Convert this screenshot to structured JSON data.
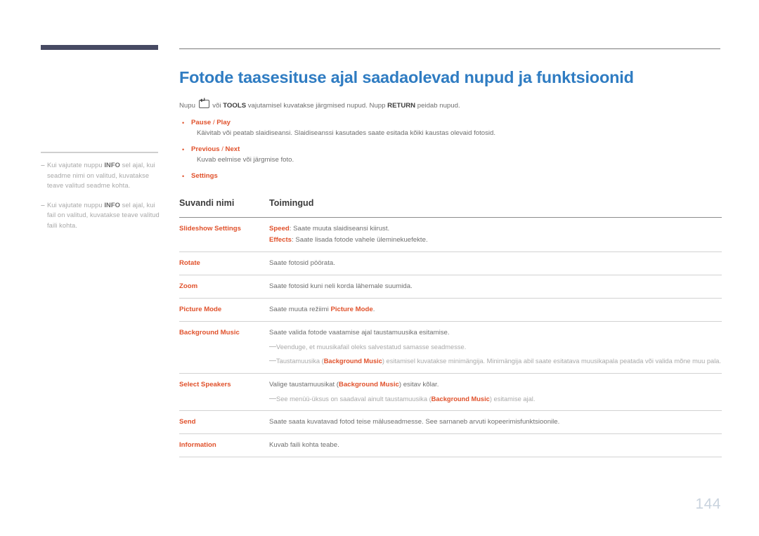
{
  "page": {
    "number": "144",
    "title": "Fotode taasesituse ajal saadaolevad nupud ja funktsioonid",
    "title_color": "#2f7cc2",
    "accent_color": "#e0512b",
    "bar_color": "#474a63"
  },
  "intro": {
    "part1": "Nupu ",
    "key_icon": "enter-key-icon",
    "part2": " või ",
    "bold1": "TOOLS",
    "part3": " vajutamisel kuvatakse järgmised nupud. Nupp ",
    "bold2": "RETURN",
    "part4": " peidab nupud."
  },
  "bullets": [
    {
      "label_a": "Pause",
      "sep": " / ",
      "label_b": "Play",
      "desc": "Käivitab või peatab slaidiseansi. Slaidiseanssi kasutades saate esitada kõiki kaustas olevaid fotosid."
    },
    {
      "label_a": "Previous",
      "sep": " / ",
      "label_b": "Next",
      "desc": "Kuvab eelmise või järgmise foto."
    },
    {
      "label_a": "Settings",
      "sep": "",
      "label_b": "",
      "desc": ""
    }
  ],
  "sidebar": {
    "notes": [
      {
        "dash": "–",
        "before": "Kui vajutate nuppu ",
        "bold": "INFO",
        "after": " sel ajal, kui seadme nimi on valitud, kuvatakse teave valitud seadme kohta."
      },
      {
        "dash": "–",
        "before": "Kui vajutate nuppu ",
        "bold": "INFO",
        "after": " sel ajal, kui fail on valitud, kuvatakse teave valitud faili kohta."
      }
    ]
  },
  "table": {
    "headers": {
      "name": "Suvandi nimi",
      "action": "Toimingud"
    },
    "rows": [
      {
        "name": "Slideshow Settings",
        "lines": [
          {
            "term": "Speed",
            "text": ": Saate muuta slaidiseansi kiirust."
          },
          {
            "term": "Effects",
            "text": ": Saate lisada fotode vahele üleminekuefekte."
          }
        ],
        "notes": []
      },
      {
        "name": "Rotate",
        "lines": [
          {
            "term": "",
            "text": "Saate fotosid pöörata."
          }
        ],
        "notes": []
      },
      {
        "name": "Zoom",
        "lines": [
          {
            "term": "",
            "text": "Saate fotosid kuni neli korda lähemale suumida."
          }
        ],
        "notes": []
      },
      {
        "name": "Picture Mode",
        "lines": [
          {
            "term": "",
            "text": "Saate muuta režiimi ",
            "term_end": "Picture Mode",
            "text_end": "."
          }
        ],
        "notes": []
      },
      {
        "name": "Background Music",
        "lines": [
          {
            "term": "",
            "text": "Saate valida fotode vaatamise ajal taustamuusika esitamise."
          }
        ],
        "notes": [
          {
            "dash": "—",
            "before": "Veenduge, et muusikafail oleks salvestatud samasse seadmesse.",
            "term": "",
            "after": ""
          },
          {
            "dash": "—",
            "before": "Taustamuusika (",
            "term": "Background Music",
            "after": ") esitamisel kuvatakse minimängija. Minimängija abil saate esitatava muusikapala peatada või valida mõne muu pala."
          }
        ]
      },
      {
        "name": "Select Speakers",
        "lines": [
          {
            "term": "",
            "text": "Valige taustamuusikat (",
            "term_end": "Background Music",
            "text_end": ") esitav kõlar."
          }
        ],
        "notes": [
          {
            "dash": "—",
            "before": "See menüü-üksus on saadaval ainult taustamuusika (",
            "term": "Background Music",
            "after": ") esitamise ajal."
          }
        ]
      },
      {
        "name": "Send",
        "lines": [
          {
            "term": "",
            "text": "Saate saata kuvatavad fotod teise mäluseadmesse. See sarnaneb arvuti kopeerimisfunktsioonile."
          }
        ],
        "notes": []
      },
      {
        "name": "Information",
        "lines": [
          {
            "term": "",
            "text": "Kuvab faili kohta teabe."
          }
        ],
        "notes": []
      }
    ]
  }
}
